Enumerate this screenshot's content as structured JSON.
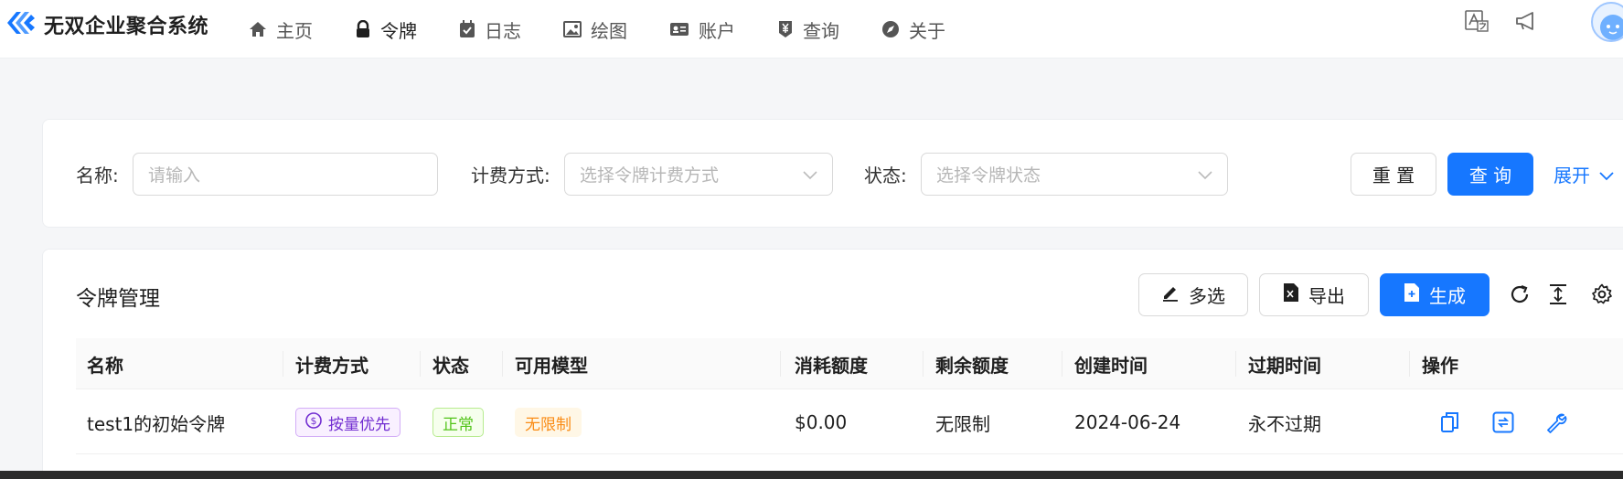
{
  "app": {
    "title": "无双企业聚合系统"
  },
  "nav": {
    "items": [
      {
        "label": "主页",
        "icon": "home-icon"
      },
      {
        "label": "令牌",
        "icon": "lock-icon",
        "active": true
      },
      {
        "label": "日志",
        "icon": "calendar-check-icon"
      },
      {
        "label": "绘图",
        "icon": "image-icon"
      },
      {
        "label": "账户",
        "icon": "id-card-icon"
      },
      {
        "label": "查询",
        "icon": "yen-tag-icon"
      },
      {
        "label": "关于",
        "icon": "compass-icon"
      }
    ]
  },
  "topbar_right": {
    "icons": [
      "translate-icon",
      "megaphone-icon",
      "avatar"
    ]
  },
  "search": {
    "name_label": "名称",
    "name_placeholder": "请输入",
    "billing_label": "计费方式",
    "billing_placeholder": "选择令牌计费方式",
    "status_label": "状态",
    "status_placeholder": "选择令牌状态",
    "reset_label": "重 置",
    "query_label": "查 询",
    "expand_label": "展开"
  },
  "list": {
    "title": "令牌管理",
    "multi_select_label": "多选",
    "export_label": "导出",
    "generate_label": "生成"
  },
  "table": {
    "columns": [
      "名称",
      "计费方式",
      "状态",
      "可用模型",
      "消耗额度",
      "剩余额度",
      "创建时间",
      "过期时间",
      "操作"
    ],
    "rows": [
      {
        "name": "test1的初始令牌",
        "billing": "按量优先",
        "status": "正常",
        "models": "无限制",
        "used": "$0.00",
        "remaining": "无限制",
        "created": "2024-06-24",
        "expires": "永不过期"
      }
    ]
  },
  "colors": {
    "primary": "#1677ff",
    "tag_purple": "#722ed1",
    "tag_green": "#52c41a",
    "tag_orange": "#fa8c16"
  }
}
